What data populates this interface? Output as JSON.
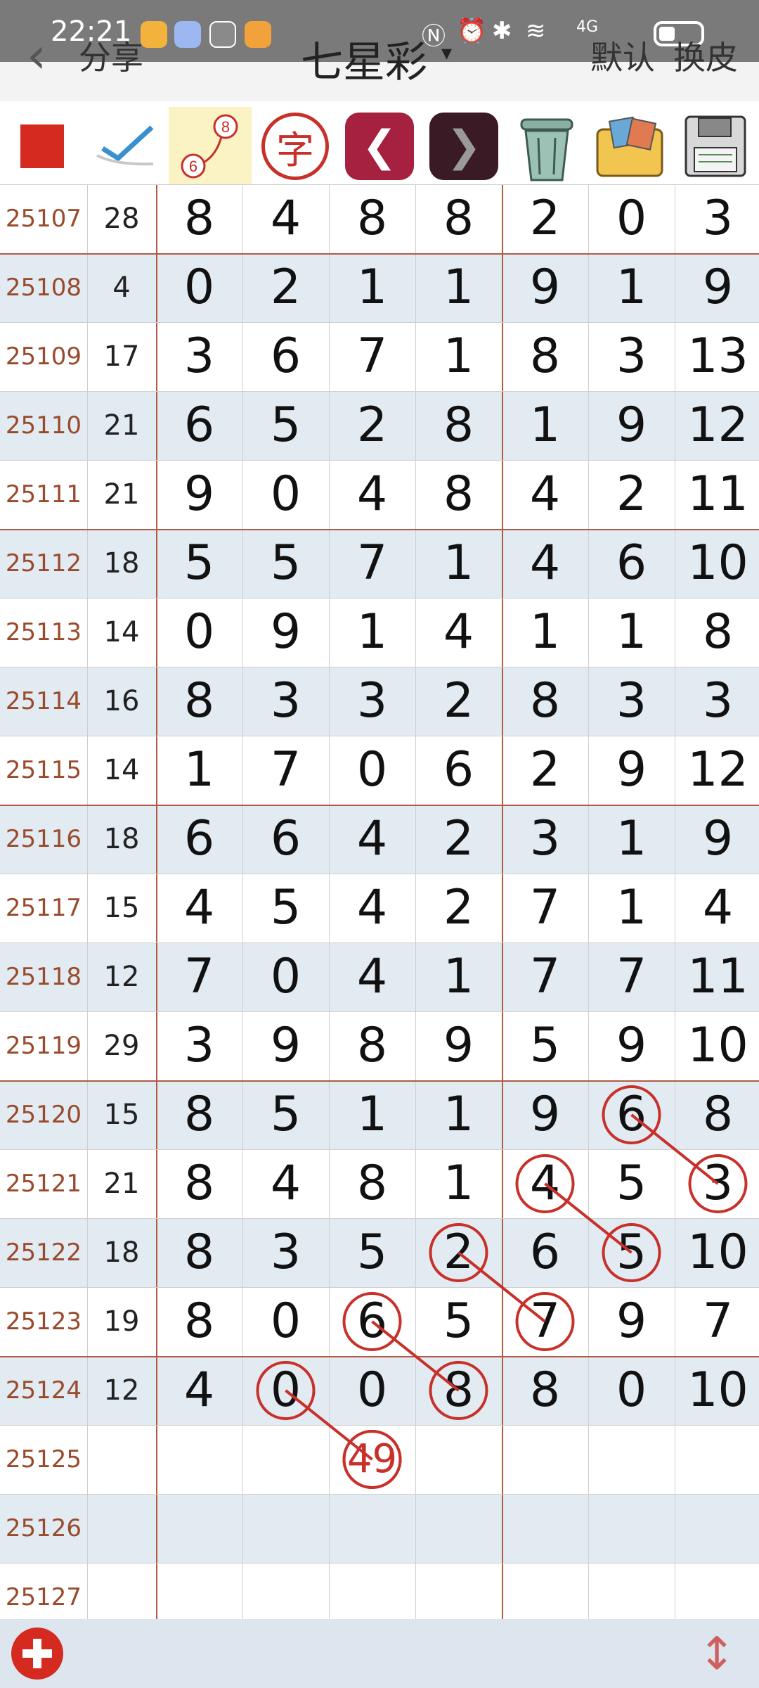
{
  "status_bar": {
    "time": "22:21",
    "network": "4G"
  },
  "header": {
    "back_label": "‹",
    "share_label": "分享",
    "title": "七星彩",
    "title_caret": "▾",
    "default_label": "默认",
    "skin_label": "换皮"
  },
  "toolbar": {
    "icons": [
      "red-square-icon",
      "pen-check-icon",
      "path-numbers-icon",
      "character-icon",
      "back-arrow-icon",
      "forward-arrow-icon",
      "trash-icon",
      "pictures-icon",
      "save-disk-icon"
    ],
    "badge_top": "8",
    "badge_bottom": "6",
    "char_label": "字"
  },
  "grid": {
    "rows": [
      {
        "issue": "25107",
        "sum": "28",
        "digits": [
          "8",
          "4",
          "8",
          "8",
          "2",
          "0",
          "3"
        ]
      },
      {
        "issue": "25108",
        "sum": "4",
        "digits": [
          "0",
          "2",
          "1",
          "1",
          "9",
          "1",
          "9"
        ]
      },
      {
        "issue": "25109",
        "sum": "17",
        "digits": [
          "3",
          "6",
          "7",
          "1",
          "8",
          "3",
          "13"
        ]
      },
      {
        "issue": "25110",
        "sum": "21",
        "digits": [
          "6",
          "5",
          "2",
          "8",
          "1",
          "9",
          "12"
        ]
      },
      {
        "issue": "25111",
        "sum": "21",
        "digits": [
          "9",
          "0",
          "4",
          "8",
          "4",
          "2",
          "11"
        ]
      },
      {
        "issue": "25112",
        "sum": "18",
        "digits": [
          "5",
          "5",
          "7",
          "1",
          "4",
          "6",
          "10"
        ]
      },
      {
        "issue": "25113",
        "sum": "14",
        "digits": [
          "0",
          "9",
          "1",
          "4",
          "1",
          "1",
          "8"
        ]
      },
      {
        "issue": "25114",
        "sum": "16",
        "digits": [
          "8",
          "3",
          "3",
          "2",
          "8",
          "3",
          "3"
        ]
      },
      {
        "issue": "25115",
        "sum": "14",
        "digits": [
          "1",
          "7",
          "0",
          "6",
          "2",
          "9",
          "12"
        ]
      },
      {
        "issue": "25116",
        "sum": "18",
        "digits": [
          "6",
          "6",
          "4",
          "2",
          "3",
          "1",
          "9"
        ]
      },
      {
        "issue": "25117",
        "sum": "15",
        "digits": [
          "4",
          "5",
          "4",
          "2",
          "7",
          "1",
          "4"
        ]
      },
      {
        "issue": "25118",
        "sum": "12",
        "digits": [
          "7",
          "0",
          "4",
          "1",
          "7",
          "7",
          "11"
        ]
      },
      {
        "issue": "25119",
        "sum": "29",
        "digits": [
          "3",
          "9",
          "8",
          "9",
          "5",
          "9",
          "10"
        ]
      },
      {
        "issue": "25120",
        "sum": "15",
        "digits": [
          "8",
          "5",
          "1",
          "1",
          "9",
          "6",
          "8"
        ]
      },
      {
        "issue": "25121",
        "sum": "21",
        "digits": [
          "8",
          "4",
          "8",
          "1",
          "4",
          "5",
          "3"
        ]
      },
      {
        "issue": "25122",
        "sum": "18",
        "digits": [
          "8",
          "3",
          "5",
          "2",
          "6",
          "5",
          "10"
        ]
      },
      {
        "issue": "25123",
        "sum": "19",
        "digits": [
          "8",
          "0",
          "6",
          "5",
          "7",
          "9",
          "7"
        ]
      },
      {
        "issue": "25124",
        "sum": "12",
        "digits": [
          "4",
          "0",
          "0",
          "8",
          "8",
          "0",
          "10"
        ]
      },
      {
        "issue": "25125",
        "sum": "",
        "digits": [
          "",
          "",
          "49",
          "",
          "",
          "",
          ""
        ]
      },
      {
        "issue": "25126",
        "sum": "",
        "digits": [
          "",
          "",
          "",
          "",
          "",
          "",
          ""
        ]
      },
      {
        "issue": "25127",
        "sum": "",
        "digits": [
          "",
          "",
          "",
          "",
          "",
          "",
          ""
        ]
      }
    ],
    "circles": [
      {
        "row": 13,
        "col": 5
      },
      {
        "row": 14,
        "col": 6
      },
      {
        "row": 14,
        "col": 4
      },
      {
        "row": 15,
        "col": 5
      },
      {
        "row": 15,
        "col": 3
      },
      {
        "row": 16,
        "col": 4
      },
      {
        "row": 16,
        "col": 2
      },
      {
        "row": 17,
        "col": 3
      },
      {
        "row": 17,
        "col": 1
      },
      {
        "row": 18,
        "col": 2
      }
    ],
    "lines": [
      {
        "from": [
          13,
          5
        ],
        "to": [
          14,
          6
        ]
      },
      {
        "from": [
          14,
          4
        ],
        "to": [
          15,
          5
        ]
      },
      {
        "from": [
          15,
          3
        ],
        "to": [
          16,
          4
        ]
      },
      {
        "from": [
          16,
          2
        ],
        "to": [
          17,
          3
        ]
      },
      {
        "from": [
          17,
          1
        ],
        "to": [
          18,
          2
        ]
      }
    ],
    "mark_color": "#c8302a"
  },
  "bottom_bar": {
    "add_icon": "add-icon",
    "scroll_icon": "scroll-arrows-icon",
    "scroll_glyph": "↕"
  }
}
